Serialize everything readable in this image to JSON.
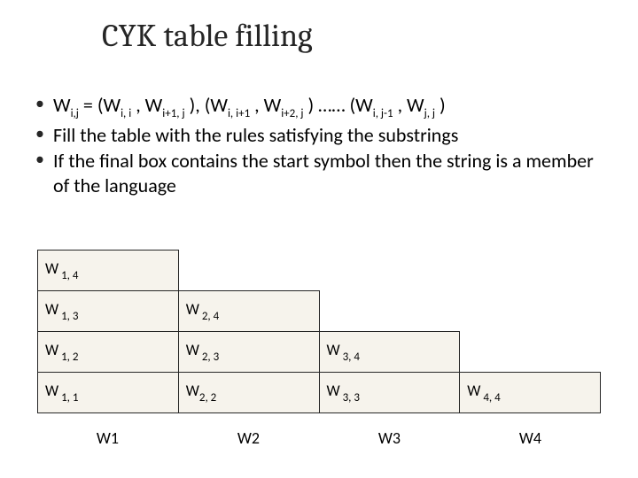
{
  "title": "CYK table filling",
  "bullets": {
    "b1_intro": "W",
    "b1_sub1": "i,j",
    "b1_t1": " =  (W",
    "b1_sub2": "i, i",
    "b1_t2": " , W",
    "b1_sub3": "i+1, j",
    "b1_t3": " ), (W",
    "b1_sub4": "i, i+1",
    "b1_t4": " , W",
    "b1_sub5": "i+2, j",
    "b1_t5": " ) …… (W",
    "b1_sub6": "i, j-1",
    "b1_t6": " , W",
    "b1_sub7": "j, j",
    "b1_t7": " )",
    "b2": "Fill the table with the rules satisfying the substrings",
    "b3": "If the final box contains the start symbol then the string is a member of the language"
  },
  "cells": {
    "c14_p": "W",
    "c14_s": " 1, 4",
    "c13_p": "W",
    "c13_s": " 1, 3",
    "c24_p": "W",
    "c24_s": " 2, 4",
    "c12_p": "W",
    "c12_s": " 1, 2",
    "c23_p": "W",
    "c23_s": " 2, 3",
    "c34_p": "W",
    "c34_s": " 3, 4",
    "c11_p": "W",
    "c11_s": " 1, 1",
    "c22_p": "W",
    "c22_s": "2, 2",
    "c33_p": "W",
    "c33_s": " 3, 3",
    "c44_p": "W",
    "c44_s": " 4, 4"
  },
  "footer": {
    "w1": "W1",
    "w2": "W2",
    "w3": "W3",
    "w4": "W4"
  }
}
